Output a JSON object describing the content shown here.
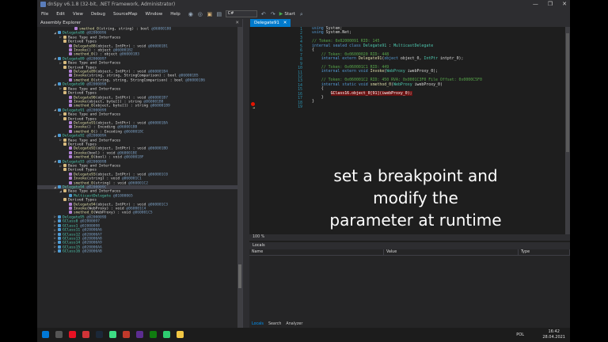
{
  "window": {
    "title": "dnSpy v6.1.8 (32-bit, .NET Framework, Administrator)",
    "controls": [
      "—",
      "❐",
      "✕"
    ]
  },
  "menu": [
    "File",
    "Edit",
    "View",
    "Debug",
    "SourceMap",
    "Window",
    "Help"
  ],
  "toolbar": {
    "language": "C#",
    "start_label": "Start"
  },
  "assembly_explorer": {
    "title": "Assembly Explorer",
    "close": "✕",
    "rows": [
      {
        "indent": 6,
        "icon": "m",
        "html": "<span class='c-meth'>smethod_0</span>(string, string) : bool <span class='c-tok'>@06000180</span>"
      },
      {
        "indent": 3,
        "icon": "t",
        "arrow": "◢",
        "html": "<span class='c-type'>Delegate88</span> <span class='c-tok'>@02000096</span>"
      },
      {
        "indent": 4,
        "icon": "f",
        "arrow": "▷",
        "html": "Base Type and Interfaces"
      },
      {
        "indent": 4,
        "icon": "f",
        "html": "Derived Types"
      },
      {
        "indent": 5,
        "icon": "m",
        "html": "<span class='c-meth'>Delegate88</span>(object, IntPtr) : void <span class='c-tok'>@060001B1</span>"
      },
      {
        "indent": 5,
        "icon": "m",
        "html": "<span class='c-meth'>Invoke</span>() : object <span class='c-tok'>@060001B2</span>"
      },
      {
        "indent": 5,
        "icon": "m",
        "html": "<span class='c-meth'>smethod_0</span>() : object <span class='c-tok'>@060001B3</span>"
      },
      {
        "indent": 3,
        "icon": "t",
        "arrow": "◢",
        "html": "<span class='c-type'>Delegate89</span> <span class='c-tok'>@02000097</span>"
      },
      {
        "indent": 4,
        "icon": "f",
        "arrow": "▷",
        "html": "Base Type and Interfaces"
      },
      {
        "indent": 4,
        "icon": "f",
        "html": "Derived Types"
      },
      {
        "indent": 5,
        "icon": "m",
        "html": "<span class='c-meth'>Delegate89</span>(object, IntPtr) : void <span class='c-tok'>@060001B4</span>"
      },
      {
        "indent": 5,
        "icon": "m",
        "html": "<span class='c-meth'>Invoke</span>(string, string, StringComparison) : bool <span class='c-tok'>@060001B5</span>"
      },
      {
        "indent": 5,
        "icon": "m",
        "html": "<span class='c-meth'>smethod_0</span>(string, string, StringComparison) : bool <span class='c-tok'>@060001B6</span>"
      },
      {
        "indent": 3,
        "icon": "t",
        "arrow": "◢",
        "html": "<span class='c-type'>Delegate90</span> <span class='c-tok'>@02000098</span>"
      },
      {
        "indent": 4,
        "icon": "f",
        "arrow": "▷",
        "html": "Base Type and Interfaces"
      },
      {
        "indent": 4,
        "icon": "f",
        "html": "Derived Types"
      },
      {
        "indent": 5,
        "icon": "m",
        "html": "<span class='c-meth'>Delegate90</span>(object, IntPtr) : void <span class='c-tok'>@060001B7</span>"
      },
      {
        "indent": 5,
        "icon": "m",
        "html": "<span class='c-meth'>Invoke</span>(object, byte[]) : string <span class='c-tok'>@060001B8</span>"
      },
      {
        "indent": 5,
        "icon": "m",
        "html": "<span class='c-meth'>smethod_0</span>(object, byte[]) : string <span class='c-tok'>@060001B9</span>"
      },
      {
        "indent": 3,
        "icon": "t",
        "arrow": "◢",
        "html": "<span class='c-type'>Delegate91</span> <span class='c-tok'>@02000099</span>"
      },
      {
        "indent": 4,
        "icon": "f",
        "arrow": "▷",
        "html": "Base Type and Interfaces"
      },
      {
        "indent": 4,
        "icon": "f",
        "html": "Derived Types"
      },
      {
        "indent": 5,
        "icon": "m",
        "html": "<span class='c-meth'>Delegate91</span>(object, IntPtr) : void <span class='c-tok'>@060001BA</span>"
      },
      {
        "indent": 5,
        "icon": "m",
        "html": "<span class='c-meth'>Invoke</span>() : Encoding <span class='c-tok'>@060001BB</span>"
      },
      {
        "indent": 5,
        "icon": "m",
        "html": "<span class='c-meth'>smethod_0</span>() : Encoding <span class='c-tok'>@060001BC</span>"
      },
      {
        "indent": 3,
        "icon": "t",
        "arrow": "◢",
        "html": "<span class='c-type'>Delegate92</span> <span class='c-tok'>@0200009A</span>"
      },
      {
        "indent": 4,
        "icon": "f",
        "arrow": "▷",
        "html": "Base Type and Interfaces"
      },
      {
        "indent": 4,
        "icon": "f",
        "html": "Derived Types"
      },
      {
        "indent": 5,
        "icon": "m",
        "html": "<span class='c-meth'>Delegate92</span>(object, IntPtr) : void <span class='c-tok'>@060001BD</span>"
      },
      {
        "indent": 5,
        "icon": "m",
        "html": "<span class='c-meth'>Invoke</span>(bool) : void <span class='c-tok'>@060001BE</span>"
      },
      {
        "indent": 5,
        "icon": "m",
        "html": "<span class='c-meth'>smethod_0</span>(bool) : void <span class='c-tok'>@060001BF</span>"
      },
      {
        "indent": 3,
        "icon": "t",
        "arrow": "◢",
        "html": "<span class='c-type'>Delegate93</span> <span class='c-tok'>@0200009B</span>"
      },
      {
        "indent": 4,
        "icon": "f",
        "arrow": "▷",
        "html": "Base Type and Interfaces"
      },
      {
        "indent": 4,
        "icon": "f",
        "html": "Derived Types"
      },
      {
        "indent": 5,
        "icon": "m",
        "html": "<span class='c-meth'>Delegate93</span>(object, IntPtr) : void <span class='c-tok'>@060001C0</span>"
      },
      {
        "indent": 5,
        "icon": "m",
        "html": "<span class='c-meth'>Invoke</span>(string) : void <span class='c-tok'>@060001C1</span>"
      },
      {
        "indent": 5,
        "icon": "m",
        "html": "<span class='c-meth'>smethod_0</span>(string) : void <span class='c-tok'>@060001C2</span>"
      },
      {
        "indent": 3,
        "icon": "t",
        "arrow": "◢",
        "html": "<span class='c-type'>Delegate94</span> <span class='c-tok'>@0200009C</span>",
        "sel": true
      },
      {
        "indent": 4,
        "icon": "f",
        "arrow": "◢",
        "html": "Base Type and Interfaces"
      },
      {
        "indent": 5,
        "icon": "t",
        "html": "<span class='c-type'>MulticastDelegate</span> <span class='c-tok'>@01000065</span>"
      },
      {
        "indent": 4,
        "icon": "f",
        "html": "Derived Types"
      },
      {
        "indent": 5,
        "icon": "m",
        "html": "<span class='c-meth'>Delegate94</span>(object, IntPtr) : void <span class='c-tok'>@060001C3</span>"
      },
      {
        "indent": 5,
        "icon": "m",
        "html": "<span class='c-meth'>Invoke</span>(WebProxy) : void <span class='c-tok'>@060001C4</span>"
      },
      {
        "indent": 5,
        "icon": "m",
        "html": "<span class='c-meth'>smethod_0</span>(WebProxy) : void <span class='c-tok'>@060001C5</span>"
      },
      {
        "indent": 3,
        "icon": "t",
        "arrow": "▷",
        "html": "<span class='c-type'>Delegate95</span> <span class='c-tok'>@0200009D</span>"
      },
      {
        "indent": 3,
        "icon": "t",
        "arrow": "▷",
        "html": "<span class='c-type'>GClass0</span> <span class='c-tok'>@02000097</span>"
      },
      {
        "indent": 3,
        "icon": "t",
        "arrow": "▷",
        "html": "<span class='c-type'>GClass1</span> <span class='c-tok'>@02000098</span>"
      },
      {
        "indent": 3,
        "icon": "t",
        "arrow": "▷",
        "html": "<span class='c-type'>GClass11</span> <span class='c-tok'>@020000A6</span>"
      },
      {
        "indent": 3,
        "icon": "t",
        "arrow": "▷",
        "html": "<span class='c-type'>GClass12</span> <span class='c-tok'>@020000A7</span>"
      },
      {
        "indent": 3,
        "icon": "t",
        "arrow": "▷",
        "html": "<span class='c-type'>GClass13</span> <span class='c-tok'>@020000A8</span>"
      },
      {
        "indent": 3,
        "icon": "t",
        "arrow": "▷",
        "html": "<span class='c-type'>GClass14</span> <span class='c-tok'>@020000A9</span>"
      },
      {
        "indent": 3,
        "icon": "t",
        "arrow": "▷",
        "html": "<span class='c-type'>GClass15</span> <span class='c-tok'>@020000AA</span>"
      },
      {
        "indent": 3,
        "icon": "t",
        "arrow": "▷",
        "html": "<span class='c-type'>GClass16</span> <span class='c-tok'>@020000AB</span>"
      }
    ]
  },
  "editor": {
    "tab": "Delegate91",
    "tab_close": "✕",
    "lines": [
      "<span class='c-kw'>using</span> System;",
      "<span class='c-kw'>using</span> System.Net;",
      "",
      "<span class='c-cm'>// Token: 0x02000091 RID: 145</span>",
      "<span class='c-kw'>internal sealed class</span> <span class='c-cls'>Delegate91</span> : <span class='c-cls'>MulticastDelegate</span>",
      "{",
      "    <span class='c-cm'>// Token: 0x06000020 RID: 448</span>",
      "    <span class='c-kw'>internal extern</span> <span class='c-meth'>Delegate91</span>(<span class='c-kw'>object</span> object_0, <span class='c-cls'>IntPtr</span> intptr_0);",
      "",
      "    <span class='c-cm'>// Token: 0x060001C1 RID: 449</span>",
      "    <span class='c-kw'>internal extern void</span> <span class='c-meth'>Invoke</span>(<span class='c-cls'>WebProxy</span> iwebProxy_0);",
      "",
      "    <span class='c-cm'>// Token: 0x060001C2 RID: 450 RVA: 0x0001C3F0 File Offset: 0x0000C5F0</span>",
      "    <span class='c-kw'>internal static void</span> <span class='c-meth'>smethod_0</span>(<span class='c-cls'>WebProxy</span> iwebProxy_0)",
      "    {",
      "        <span class='hl'>GClass16.object_0[91](iwebProxy_0);</span>",
      "    }",
      "}",
      ""
    ],
    "zoom": "100 %"
  },
  "locals": {
    "title": "Locals",
    "columns": [
      "Name",
      "Value",
      "Type"
    ],
    "tabs": [
      "Locals",
      "Search",
      "Analyzer"
    ]
  },
  "caption": {
    "line1": "set a breakpoint and",
    "line2": "modify the",
    "line3": "parameter at runtime"
  },
  "taskbar": {
    "time": "16:42",
    "date": "28.04.2021",
    "lang": "POL",
    "colors": [
      "#0078d7",
      "#555555",
      "#e81123",
      "#d13438",
      "#1b2838",
      "#3ddc84",
      "#c0392b",
      "#5c2d91",
      "#107c10",
      "#2ecc71",
      "#f2c744"
    ]
  }
}
